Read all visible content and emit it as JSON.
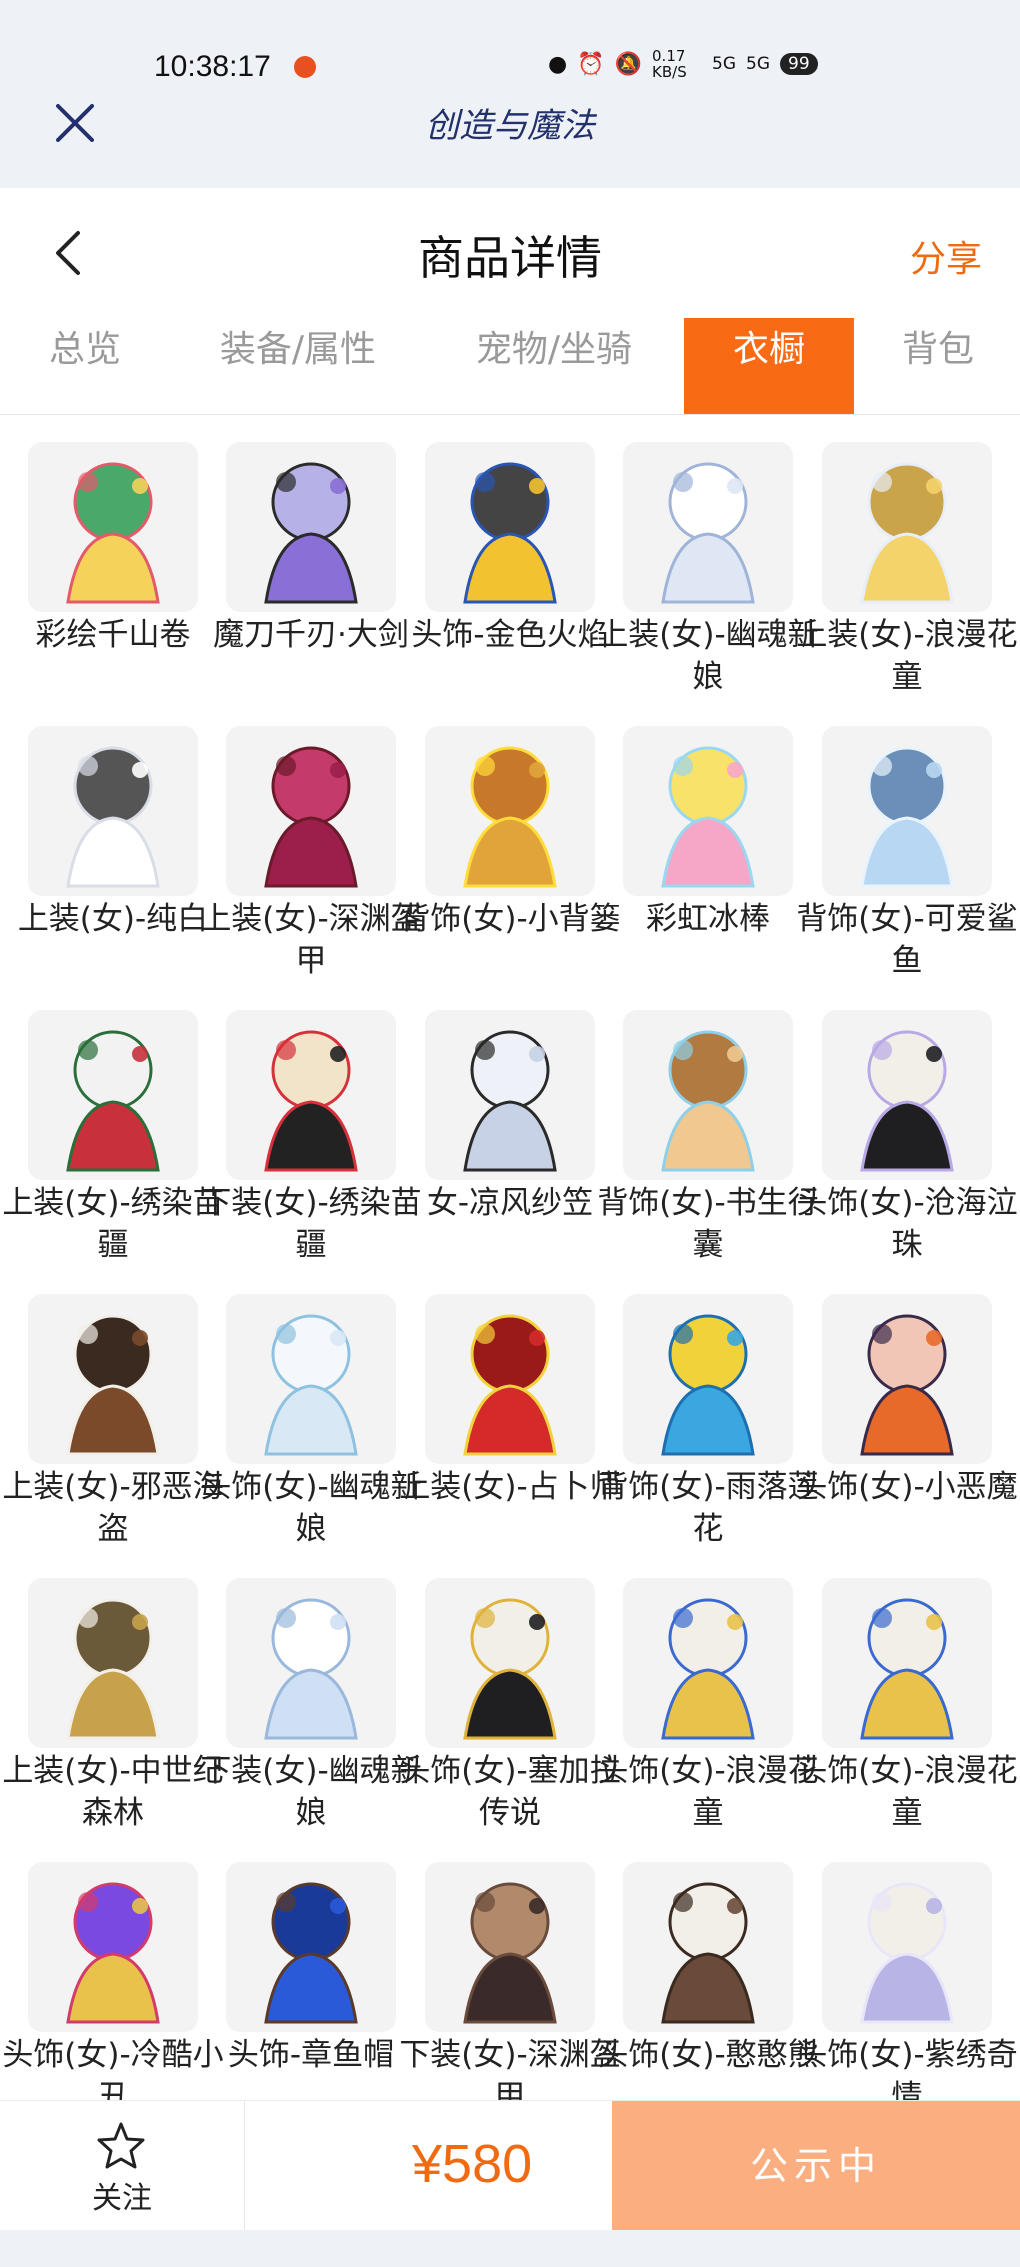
{
  "status_bar": {
    "time": "10:38:17",
    "network_speed": "0.17 KB/S",
    "signal_1": "5G",
    "signal_2": "5G",
    "battery": "99"
  },
  "app": {
    "title": "创造与魔法"
  },
  "header": {
    "title": "商品详情",
    "share_label": "分享"
  },
  "tabs": [
    {
      "label": "总览",
      "active": false
    },
    {
      "label": "装备/属性",
      "active": false
    },
    {
      "label": "宠物/坐骑",
      "active": false
    },
    {
      "label": "衣橱",
      "active": true
    },
    {
      "label": "背包",
      "active": false
    }
  ],
  "items": [
    {
      "name": "彩绘千山卷",
      "icon": "painted-scroll-icon"
    },
    {
      "name": "魔刀千刃·大剑",
      "icon": "katana-icon"
    },
    {
      "name": "头饰-金色火焰",
      "icon": "yellow-cap-headphones-icon"
    },
    {
      "name": "上装(女)-幽魂新娘",
      "icon": "ghost-bride-outfit-icon"
    },
    {
      "name": "上装(女)-浪漫花童",
      "icon": "romantic-flower-dress-icon"
    },
    {
      "name": "上装(女)-纯白",
      "icon": "white-dress-icon"
    },
    {
      "name": "上装(女)-深渊盔甲",
      "icon": "abyss-armor-icon"
    },
    {
      "name": "背饰(女)-小背篓",
      "icon": "flower-basket-icon"
    },
    {
      "name": "彩虹冰棒",
      "icon": "rainbow-popsicle-icon"
    },
    {
      "name": "背饰(女)-可爱鲨鱼",
      "icon": "cute-shark-icon"
    },
    {
      "name": "上装(女)-绣染苗疆",
      "icon": "embroidered-top-icon"
    },
    {
      "name": "下装(女)-绣染苗疆",
      "icon": "embroidered-skirt-icon"
    },
    {
      "name": "女-凉风纱笠",
      "icon": "veil-hat-icon"
    },
    {
      "name": "背饰(女)-书生行囊",
      "icon": "scholar-backpack-icon"
    },
    {
      "name": "头饰(女)-沧海泣珠",
      "icon": "black-hair-headdress-icon"
    },
    {
      "name": "上装(女)-邪恶海盗",
      "icon": "pirate-outfit-icon"
    },
    {
      "name": "头饰(女)-幽魂新娘",
      "icon": "ghost-bride-head-icon"
    },
    {
      "name": "上装(女)-占卜师",
      "icon": "fortune-teller-dress-icon"
    },
    {
      "name": "背饰(女)-雨落莲花",
      "icon": "lotus-umbrella-icon"
    },
    {
      "name": "头饰(女)-小恶魔",
      "icon": "little-devil-head-icon"
    },
    {
      "name": "上装(女)-中世纪森林",
      "icon": "medieval-forest-outfit-icon"
    },
    {
      "name": "下装(女)-幽魂新娘",
      "icon": "ghost-bride-pants-icon"
    },
    {
      "name": "头饰(女)-塞加拉传说",
      "icon": "segara-headdress-icon"
    },
    {
      "name": "头饰(女)-浪漫花童",
      "icon": "romantic-flower-head-icon"
    },
    {
      "name": "头饰(女)-浪漫花童",
      "icon": "romantic-flower-head-icon"
    },
    {
      "name": "头饰(女)-冷酷小丑",
      "icon": "cool-clown-head-icon"
    },
    {
      "name": "头饰-章鱼帽",
      "icon": "octopus-hat-icon"
    },
    {
      "name": "下装(女)-深渊盔甲",
      "icon": "abyss-boots-icon"
    },
    {
      "name": "头饰(女)-憨憨熊",
      "icon": "bear-ears-head-icon"
    },
    {
      "name": "头饰(女)-紫绣奇情",
      "icon": "purple-hair-head-icon"
    }
  ],
  "bottom_bar": {
    "follow_label": "关注",
    "price": "¥580",
    "status_label": "公示中"
  },
  "colors": {
    "accent": "#f96a14",
    "status_button": "#fbae80",
    "status_bar_bg": "#eef2f6"
  }
}
